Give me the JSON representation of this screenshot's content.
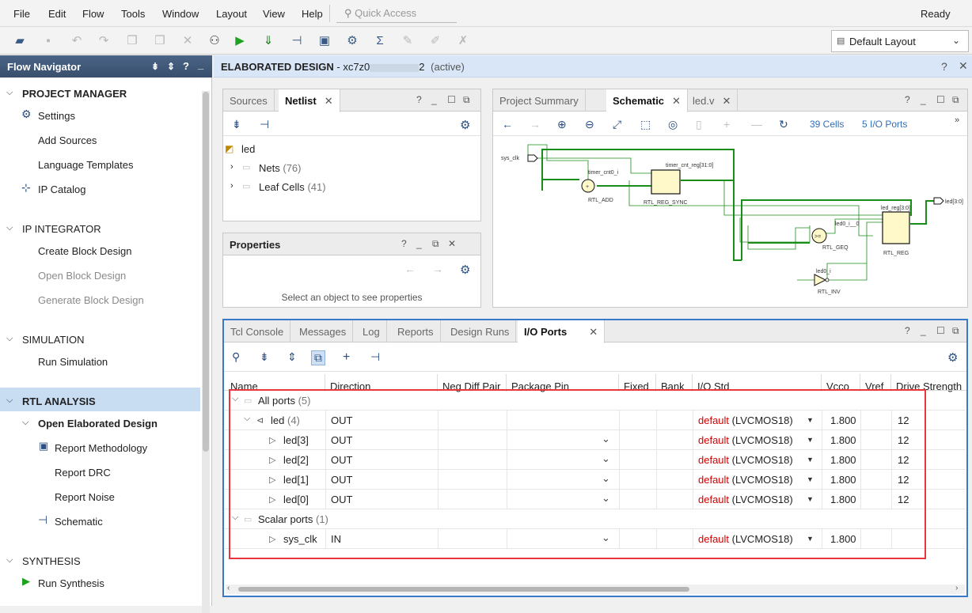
{
  "menu": {
    "items": [
      "File",
      "Edit",
      "Flow",
      "Tools",
      "Window",
      "Layout",
      "View",
      "Help"
    ],
    "quick_access_placeholder": "Quick Access",
    "status": "Ready"
  },
  "toolbar": {
    "layout_select": "Default Layout"
  },
  "nav": {
    "title": "Flow Navigator",
    "sections": {
      "project_manager": "PROJECT MANAGER",
      "ip_integrator": "IP INTEGRATOR",
      "simulation": "SIMULATION",
      "rtl_analysis": "RTL ANALYSIS",
      "synthesis": "SYNTHESIS"
    },
    "items": {
      "settings": "Settings",
      "add_sources": "Add Sources",
      "language_templates": "Language Templates",
      "ip_catalog": "IP Catalog",
      "create_block_design": "Create Block Design",
      "open_block_design": "Open Block Design",
      "generate_block_design": "Generate Block Design",
      "run_simulation": "Run Simulation",
      "open_elaborated_design": "Open Elaborated Design",
      "report_methodology": "Report Methodology",
      "report_drc": "Report DRC",
      "report_noise": "Report Noise",
      "schematic": "Schematic",
      "run_synthesis": "Run Synthesis"
    }
  },
  "design_header": {
    "title": "ELABORATED DESIGN",
    "device": "- xc7z0",
    "device_suffix": "2",
    "status": "(active)"
  },
  "sources_panel": {
    "tabs": [
      "Sources",
      "Netlist"
    ],
    "tree": {
      "root": "led",
      "nets": "Nets",
      "nets_count": "(76)",
      "leaf_cells": "Leaf Cells",
      "leaf_cells_count": "(41)"
    }
  },
  "properties_panel": {
    "title": "Properties",
    "empty_msg": "Select an object to see properties"
  },
  "schematic_panel": {
    "tabs": [
      "Project Summary",
      "Schematic",
      "led.v"
    ],
    "cells": "39 Cells",
    "io_ports": "5 I/O Ports",
    "labels": {
      "sys_clk": "sys_clk",
      "timer_cnt0_i": "timer_cnt0_i",
      "rtl_add": "RTL_ADD",
      "timer_cnt_reg": "timer_cnt_reg[31:0]",
      "rtl_reg_sync": "RTL_REG_SYNC",
      "led_reg": "led_reg[3:0]",
      "rtl_reg": "RTL_REG",
      "led0_i_0": "led0_i__0",
      "rtl_geq": "RTL_GEQ",
      "led0_i": "led0_i",
      "rtl_inv": "RTL_INV",
      "led_out": "led[3:0]",
      "add_sym": "+",
      "geq_sym": ">="
    }
  },
  "bottom_panel": {
    "tabs": [
      "Tcl Console",
      "Messages",
      "Log",
      "Reports",
      "Design Runs",
      "I/O Ports"
    ],
    "columns": [
      "Name",
      "Direction",
      "Neg Diff Pair",
      "Package Pin",
      "Fixed",
      "Bank",
      "I/O Std",
      "Vcco",
      "Vref",
      "Drive Strength"
    ],
    "rows": [
      {
        "name": "All ports",
        "count": "(5)",
        "direction": "",
        "iostd_default": "",
        "iostd_std": "",
        "vcco": "",
        "drive": "",
        "type": "group"
      },
      {
        "name": "led",
        "count": "(4)",
        "direction": "OUT",
        "iostd_default": "default",
        "iostd_std": "(LVCMOS18)",
        "vcco": "1.800",
        "drive": "12",
        "type": "bus"
      },
      {
        "name": "led[3]",
        "count": "",
        "direction": "OUT",
        "iostd_default": "default",
        "iostd_std": "(LVCMOS18)",
        "vcco": "1.800",
        "drive": "12",
        "type": "port"
      },
      {
        "name": "led[2]",
        "count": "",
        "direction": "OUT",
        "iostd_default": "default",
        "iostd_std": "(LVCMOS18)",
        "vcco": "1.800",
        "drive": "12",
        "type": "port"
      },
      {
        "name": "led[1]",
        "count": "",
        "direction": "OUT",
        "iostd_default": "default",
        "iostd_std": "(LVCMOS18)",
        "vcco": "1.800",
        "drive": "12",
        "type": "port"
      },
      {
        "name": "led[0]",
        "count": "",
        "direction": "OUT",
        "iostd_default": "default",
        "iostd_std": "(LVCMOS18)",
        "vcco": "1.800",
        "drive": "12",
        "type": "port"
      },
      {
        "name": "Scalar ports",
        "count": "(1)",
        "direction": "",
        "iostd_default": "",
        "iostd_std": "",
        "vcco": "",
        "drive": "",
        "type": "group"
      },
      {
        "name": "sys_clk",
        "count": "",
        "direction": "IN",
        "iostd_default": "default",
        "iostd_std": "(LVCMOS18)",
        "vcco": "1.800",
        "drive": "",
        "type": "port"
      }
    ]
  },
  "colors": {
    "highlight_red": "#e8373d",
    "highlight_blue": "#3a78c8",
    "accent": "#2a4f80"
  }
}
